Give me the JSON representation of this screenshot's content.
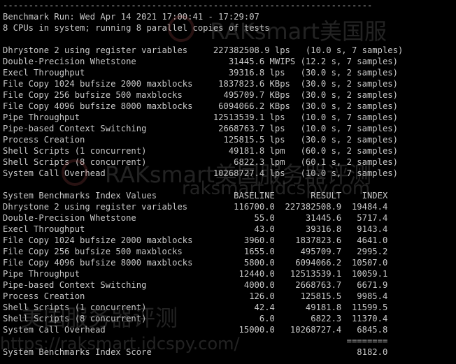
{
  "lines": [
    "------------------------------------------------------------------------",
    "Benchmark Run: Wed Apr 14 2021 17:00:41 - 17:29:07",
    "8 CPUs in system; running 8 parallel copies of tests",
    "",
    "Dhrystone 2 using register variables     227382508.9 lps   (10.0 s, 7 samples)",
    "Double-Precision Whetstone                  31445.6 MWIPS (12.2 s, 7 samples)",
    "Execl Throughput                            39316.8 lps   (30.0 s, 2 samples)",
    "File Copy 1024 bufsize 2000 maxblocks     1837823.6 KBps  (30.0 s, 2 samples)",
    "File Copy 256 bufsize 500 maxblocks        495709.7 KBps  (30.0 s, 2 samples)",
    "File Copy 4096 bufsize 8000 maxblocks     6094066.2 KBps  (30.0 s, 2 samples)",
    "Pipe Throughput                          12513539.1 lps   (10.0 s, 7 samples)",
    "Pipe-based Context Switching              2668763.7 lps   (10.0 s, 7 samples)",
    "Process Creation                           125815.5 lps   (30.0 s, 2 samples)",
    "Shell Scripts (1 concurrent)                49181.8 lpm   (60.0 s, 2 samples)",
    "Shell Scripts (8 concurrent)                 6822.3 lpm   (60.1 s, 2 samples)",
    "System Call Overhead                     10268727.4 lps   (10.0 s, 7 samples)",
    "",
    "System Benchmarks Index Values               BASELINE       RESULT    INDEX",
    "Dhrystone 2 using register variables         116700.0  227382508.9  19484.4",
    "Double-Precision Whetstone                       55.0      31445.6   5717.4",
    "Execl Throughput                                 43.0      39316.8   9143.4",
    "File Copy 1024 bufsize 2000 maxblocks          3960.0    1837823.6   4641.0",
    "File Copy 256 bufsize 500 maxblocks            1655.0     495709.7   2995.2",
    "File Copy 4096 bufsize 8000 maxblocks          5800.0    6094066.2  10507.0",
    "Pipe Throughput                               12440.0   12513539.1  10059.1",
    "Pipe-based Context Switching                   4000.0    2668763.7   6671.9",
    "Process Creation                                126.0     125815.5   9985.4",
    "Shell Scripts (1 concurrent)                     42.4      49181.8  11599.5",
    "Shell Scripts (8 concurrent)                      6.0       6822.3  11370.4",
    "System Call Overhead                          15000.0   10268727.4   6845.8",
    "                                                                   ========",
    "System Benchmarks Index Score                                        8182.0"
  ],
  "watermarks": {
    "w1": "RAKsmart美国服",
    "w2": "RAKsmart美国服务器评测",
    "w3": "raksmart.idcspy.com",
    "w4": "美国服务器评测",
    "w5": "https://raksmart.idcspy.com/"
  },
  "colors": {
    "background": "#000000",
    "text": "#c8c8c8"
  }
}
